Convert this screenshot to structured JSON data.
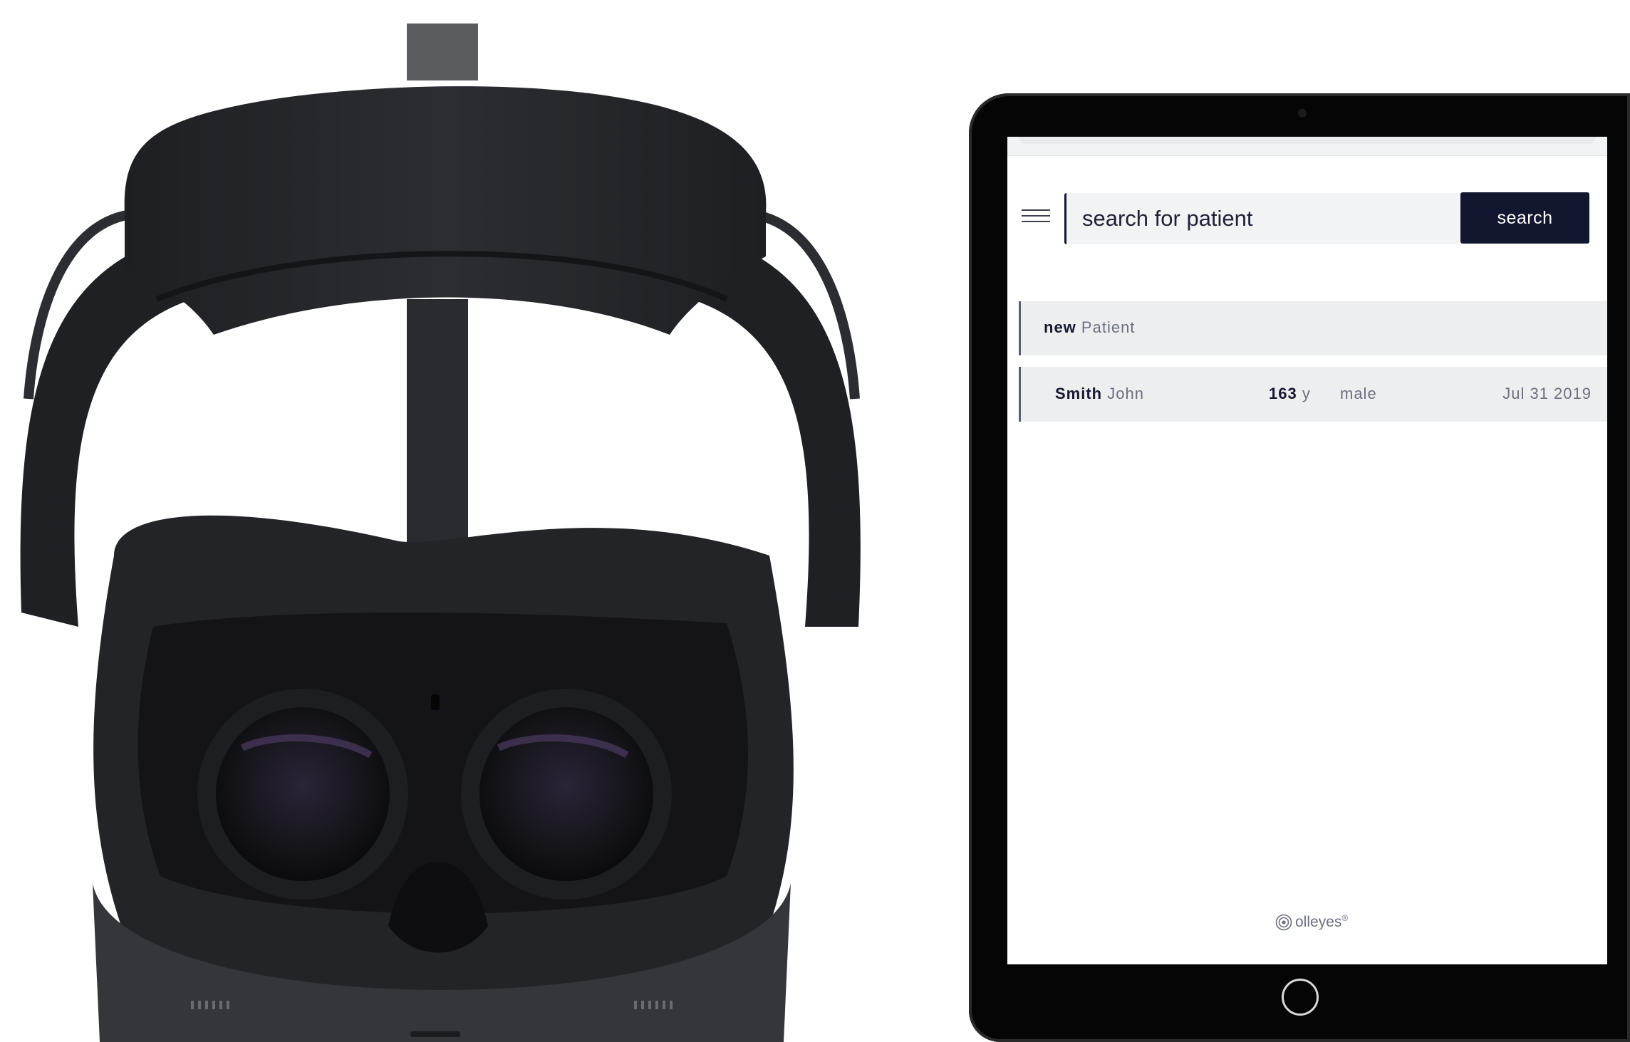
{
  "search": {
    "placeholder": "search for patient",
    "button_label": "search"
  },
  "new_patient": {
    "bold_label": "new",
    "label": "Patient"
  },
  "patients": [
    {
      "last_name": "Smith",
      "first_name": "John",
      "age": "163",
      "age_unit": "y",
      "gender": "male",
      "date": "Jul 31 2019"
    }
  ],
  "footer": {
    "brand": "olleyes",
    "trademark": "®"
  },
  "icons": {
    "menu": "hamburger-menu-icon",
    "logo": "olleyes-logo-icon"
  },
  "colors": {
    "accent": "#12162f",
    "row_background": "#edeef0",
    "tablet_bezel": "#050505"
  }
}
